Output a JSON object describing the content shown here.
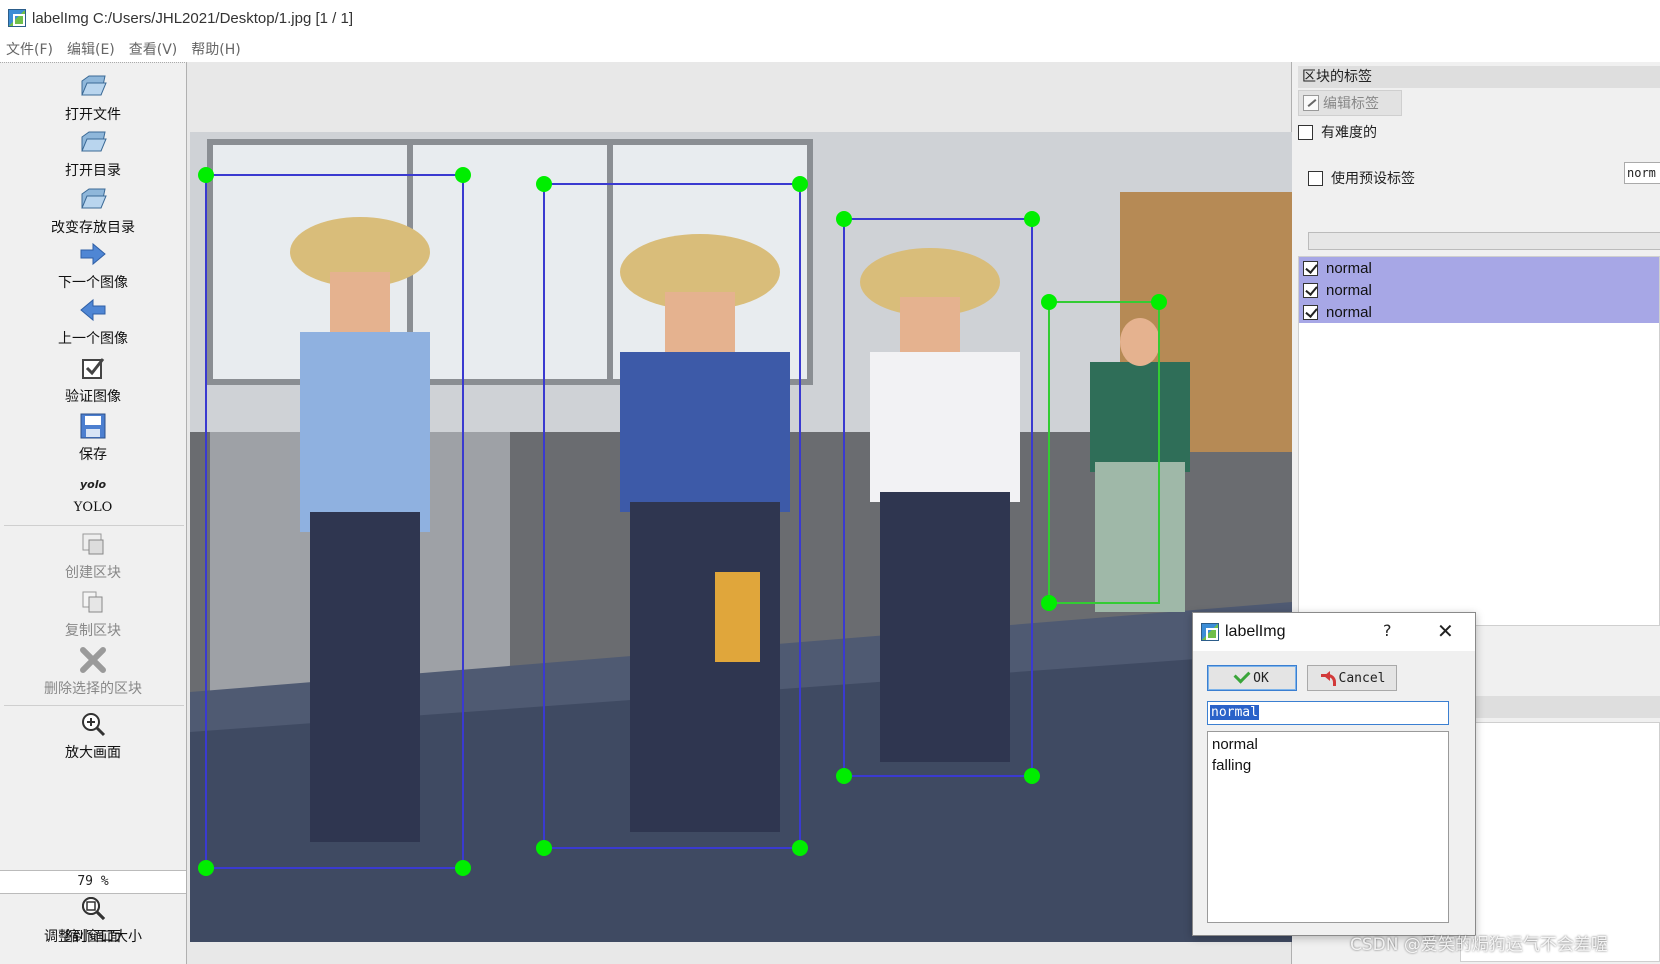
{
  "window": {
    "title": "labelImg C:/Users/JHL2021/Desktop/1.jpg [1 / 1]"
  },
  "menu": [
    {
      "label": "文件(F)"
    },
    {
      "label": "编辑(E)"
    },
    {
      "label": "查看(V)"
    },
    {
      "label": "帮助(H)"
    }
  ],
  "toolbar": {
    "open_file": "打开文件",
    "open_dir": "打开目录",
    "change_save_dir": "改变存放目录",
    "next_image": "下一个图像",
    "prev_image": "上一个图像",
    "verify_image": "验证图像",
    "save": "保存",
    "format_icon_text": "yolo",
    "format": "YOLO",
    "create_box": "创建区块",
    "duplicate_box": "复制区块",
    "delete_box": "删除选择的区块",
    "zoom_in": "放大画面",
    "zoom_level": "79 %",
    "zoom_out": "缩小画面",
    "fit_window": "调整到窗口大小"
  },
  "dock": {
    "title": "区块的标签",
    "edit_label": "编辑标签",
    "difficult": "有难度的",
    "use_default_label": "使用预设标签",
    "default_label_value": "norm",
    "labels": [
      {
        "text": "normal",
        "checked": true
      },
      {
        "text": "normal",
        "checked": true
      },
      {
        "text": "normal",
        "checked": true
      }
    ]
  },
  "dialog": {
    "title": "labelImg",
    "help": "?",
    "close": "✕",
    "ok": "OK",
    "cancel": "Cancel",
    "input_value": "normal",
    "options": [
      "normal",
      "falling"
    ]
  },
  "watermark": "CSDN @爱笑的焗狗运气不会差喔",
  "colors": {
    "box_blue": "#3a3ad0",
    "box_green": "#33cc33",
    "handle": "#00ee00",
    "selected_row": "#a7a7e6"
  }
}
